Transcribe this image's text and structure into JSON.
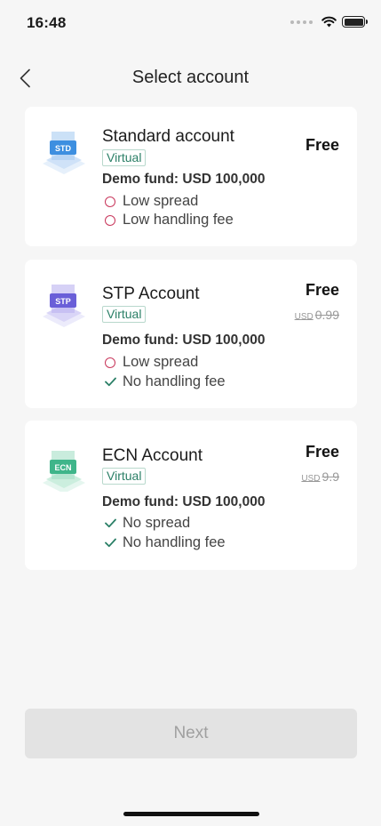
{
  "status_bar": {
    "time": "16:48"
  },
  "nav": {
    "title": "Select account"
  },
  "accounts": [
    {
      "name": "Standard account",
      "tag": "Virtual",
      "demo_fund": "Demo fund: USD 100,000",
      "price": "Free",
      "old_price_currency": "",
      "old_price_value": "",
      "icon_label": "STD",
      "icon_color": "#3d8fe0",
      "features": [
        {
          "text": "Low spread",
          "mark": "circle"
        },
        {
          "text": "Low handling fee",
          "mark": "circle"
        }
      ]
    },
    {
      "name": "STP Account",
      "tag": "Virtual",
      "demo_fund": "Demo fund: USD 100,000",
      "price": "Free",
      "old_price_currency": "USD",
      "old_price_value": "0.99",
      "icon_label": "STP",
      "icon_color": "#6a5fd8",
      "features": [
        {
          "text": "Low spread",
          "mark": "circle"
        },
        {
          "text": "No handling fee",
          "mark": "check"
        }
      ]
    },
    {
      "name": "ECN Account",
      "tag": "Virtual",
      "demo_fund": "Demo fund: USD 100,000",
      "price": "Free",
      "old_price_currency": "USD",
      "old_price_value": "9.9",
      "icon_label": "ECN",
      "icon_color": "#3fb58a",
      "features": [
        {
          "text": "No spread",
          "mark": "check"
        },
        {
          "text": "No handling fee",
          "mark": "check"
        }
      ]
    }
  ],
  "next_button": {
    "label": "Next"
  }
}
